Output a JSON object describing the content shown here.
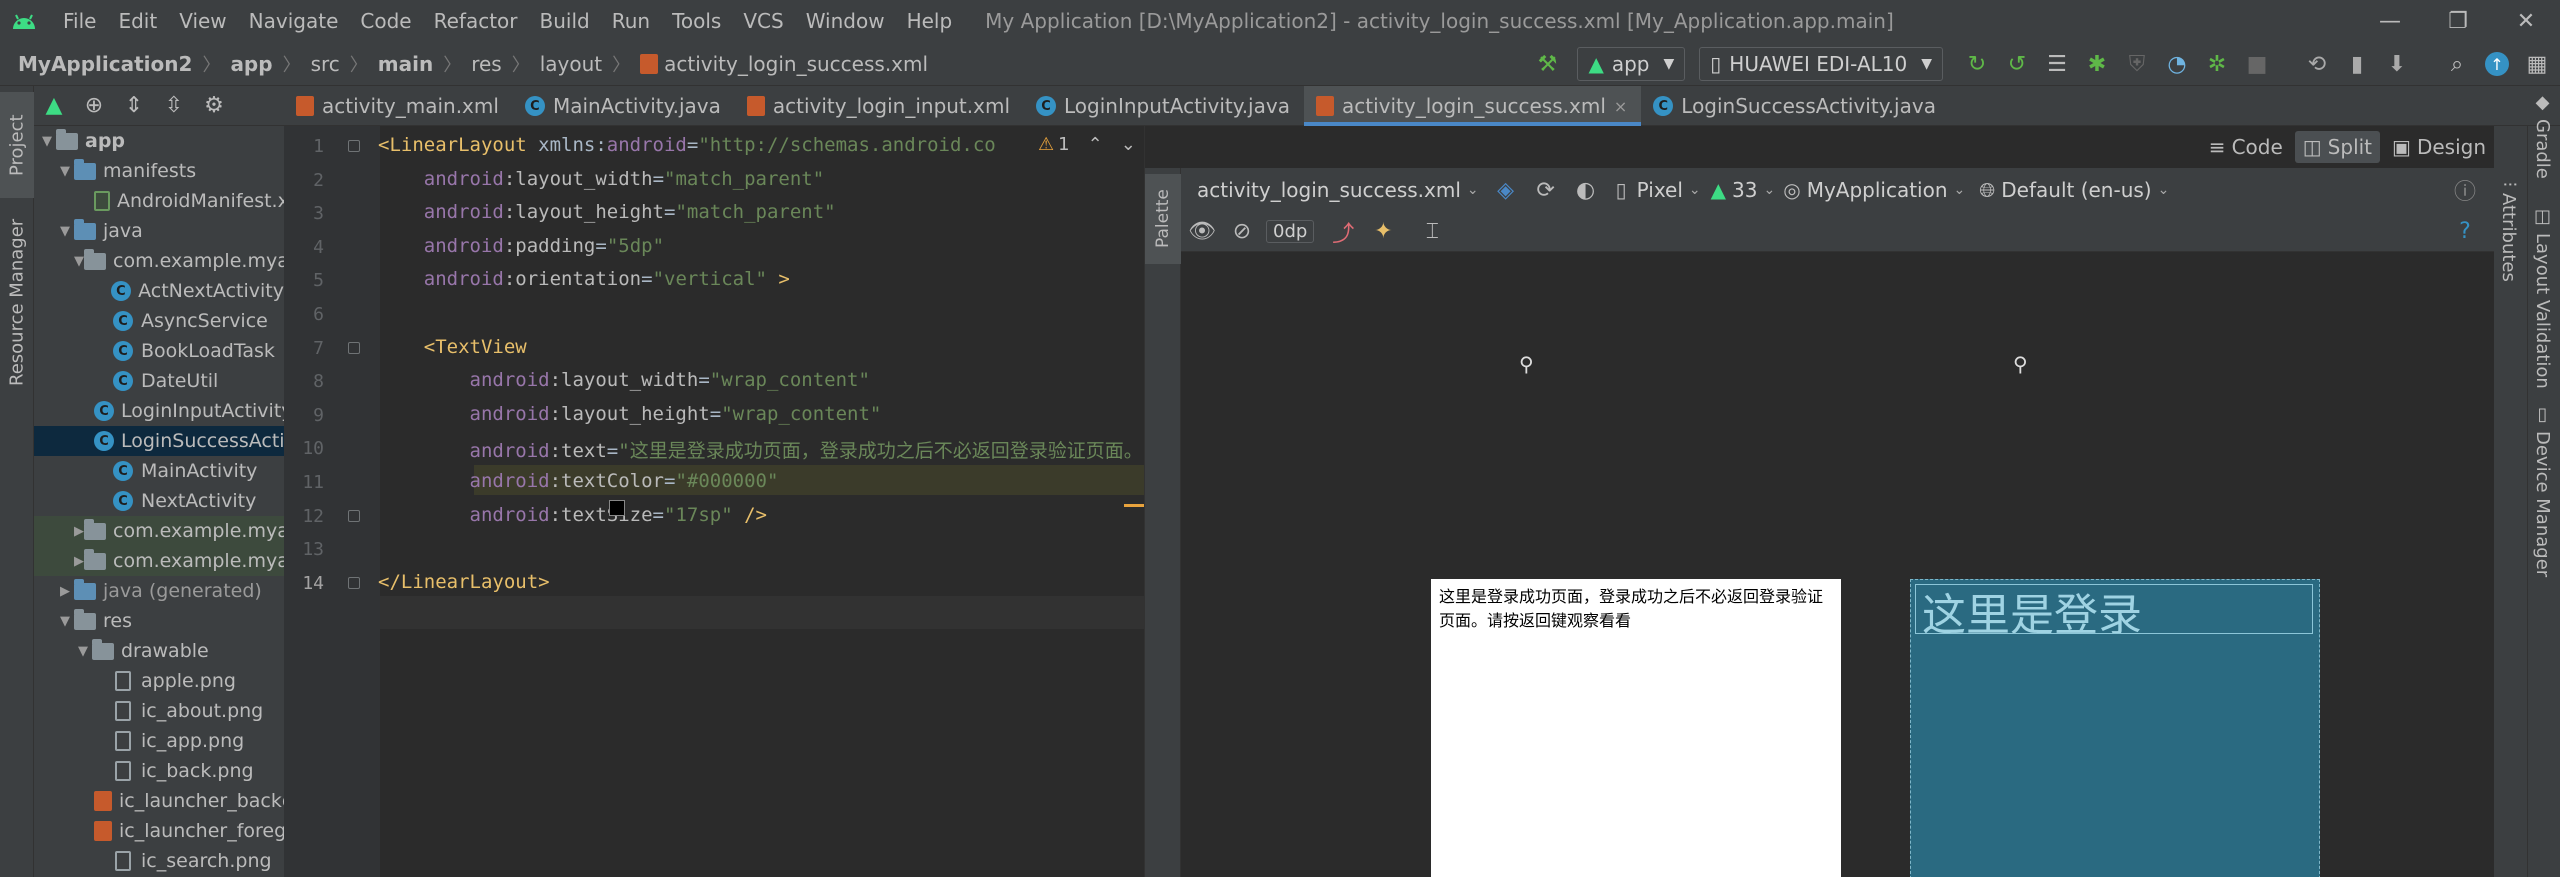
{
  "menu": [
    "File",
    "Edit",
    "View",
    "Navigate",
    "Code",
    "Refactor",
    "Build",
    "Run",
    "Tools",
    "VCS",
    "Window",
    "Help"
  ],
  "window_title": "My Application [D:\\MyApplication2] - activity_login_success.xml [My_Application.app.main]",
  "window_controls": {
    "minimize": "—",
    "restore": "❐",
    "close": "✕"
  },
  "breadcrumbs": [
    "MyApplication2",
    "app",
    "src",
    "main",
    "res",
    "layout",
    "activity_login_success.xml"
  ],
  "run_config": "app",
  "device": "HUAWEI EDI-AL10",
  "left_strip": {
    "project": "Project",
    "resource_manager": "Resource Manager"
  },
  "project_tree": [
    {
      "label": "app",
      "depth": 0,
      "arrow": "▼",
      "icon": "folder",
      "bold": true
    },
    {
      "label": "manifests",
      "depth": 1,
      "arrow": "▼",
      "icon": "folder-blue"
    },
    {
      "label": "AndroidManifest.xml",
      "depth": 3,
      "arrow": "",
      "icon": "manifest"
    },
    {
      "label": "java",
      "depth": 1,
      "arrow": "▼",
      "icon": "folder-blue"
    },
    {
      "label": "com.example.myapplication",
      "depth": 2,
      "arrow": "▼",
      "icon": "folder"
    },
    {
      "label": "ActNextActivity",
      "depth": 3,
      "arrow": "",
      "icon": "class"
    },
    {
      "label": "AsyncService",
      "depth": 3,
      "arrow": "",
      "icon": "class"
    },
    {
      "label": "BookLoadTask",
      "depth": 3,
      "arrow": "",
      "icon": "class"
    },
    {
      "label": "DateUtil",
      "depth": 3,
      "arrow": "",
      "icon": "class"
    },
    {
      "label": "LoginInputActivity",
      "depth": 3,
      "arrow": "",
      "icon": "class"
    },
    {
      "label": "LoginSuccessActivity",
      "depth": 3,
      "arrow": "",
      "icon": "class",
      "selected": true
    },
    {
      "label": "MainActivity",
      "depth": 3,
      "arrow": "",
      "icon": "class"
    },
    {
      "label": "NextActivity",
      "depth": 3,
      "arrow": "",
      "icon": "class"
    },
    {
      "label": "com.example.myapplication (androidTest)",
      "depth": 2,
      "arrow": "▶",
      "icon": "folder",
      "tinted": true
    },
    {
      "label": "com.example.myapplication (test)",
      "depth": 2,
      "arrow": "▶",
      "icon": "folder",
      "tinted": true
    },
    {
      "label": "java (generated)",
      "depth": 1,
      "arrow": "▶",
      "icon": "folder-blue",
      "dim": true
    },
    {
      "label": "res",
      "depth": 1,
      "arrow": "▼",
      "icon": "folder"
    },
    {
      "label": "drawable",
      "depth": 2,
      "arrow": "▼",
      "icon": "folder"
    },
    {
      "label": "apple.png",
      "depth": 3,
      "arrow": "",
      "icon": "image"
    },
    {
      "label": "ic_about.png",
      "depth": 3,
      "arrow": "",
      "icon": "image"
    },
    {
      "label": "ic_app.png",
      "depth": 3,
      "arrow": "",
      "icon": "image"
    },
    {
      "label": "ic_back.png",
      "depth": 3,
      "arrow": "",
      "icon": "image"
    },
    {
      "label": "ic_launcher_background.xml",
      "depth": 3,
      "arrow": "",
      "icon": "xml"
    },
    {
      "label": "ic_launcher_foreground.xml",
      "depth": 3,
      "arrow": "",
      "icon": "xml"
    },
    {
      "label": "ic_search.png",
      "depth": 3,
      "arrow": "",
      "icon": "image"
    }
  ],
  "tabs": [
    {
      "label": "activity_main.xml",
      "icon": "xml"
    },
    {
      "label": "MainActivity.java",
      "icon": "class"
    },
    {
      "label": "activity_login_input.xml",
      "icon": "xml"
    },
    {
      "label": "LoginInputActivity.java",
      "icon": "class"
    },
    {
      "label": "activity_login_success.xml",
      "icon": "xml",
      "active": true,
      "close": "×"
    },
    {
      "label": "LoginSuccessActivity.java",
      "icon": "class"
    }
  ],
  "editor": {
    "line_numbers": [
      "1",
      "2",
      "3",
      "4",
      "5",
      "6",
      "7",
      "8",
      "9",
      "10",
      "11",
      "12",
      "13",
      "14"
    ],
    "warning_count": "1",
    "lines": [
      [
        {
          "t": "tag",
          "v": "<LinearLayout"
        },
        {
          "t": "plain",
          "v": " xmlns:"
        },
        {
          "t": "ns",
          "v": "android"
        },
        {
          "t": "plain",
          "v": "="
        },
        {
          "t": "str",
          "v": "\"http://schemas.android.co"
        }
      ],
      [
        {
          "t": "plain",
          "v": "    "
        },
        {
          "t": "ns",
          "v": "android"
        },
        {
          "t": "attr",
          "v": ":layout_width"
        },
        {
          "t": "plain",
          "v": "="
        },
        {
          "t": "str",
          "v": "\"match_parent\""
        }
      ],
      [
        {
          "t": "plain",
          "v": "    "
        },
        {
          "t": "ns",
          "v": "android"
        },
        {
          "t": "attr",
          "v": ":layout_height"
        },
        {
          "t": "plain",
          "v": "="
        },
        {
          "t": "str",
          "v": "\"match_parent\""
        }
      ],
      [
        {
          "t": "plain",
          "v": "    "
        },
        {
          "t": "ns",
          "v": "android"
        },
        {
          "t": "attr",
          "v": ":padding"
        },
        {
          "t": "plain",
          "v": "="
        },
        {
          "t": "str",
          "v": "\"5dp\""
        }
      ],
      [
        {
          "t": "plain",
          "v": "    "
        },
        {
          "t": "ns",
          "v": "android"
        },
        {
          "t": "attr",
          "v": ":orientation"
        },
        {
          "t": "plain",
          "v": "="
        },
        {
          "t": "str",
          "v": "\"vertical\""
        },
        {
          "t": "tag",
          "v": " >"
        }
      ],
      [],
      [
        {
          "t": "plain",
          "v": "    "
        },
        {
          "t": "tag",
          "v": "<TextView"
        }
      ],
      [
        {
          "t": "plain",
          "v": "        "
        },
        {
          "t": "ns",
          "v": "android"
        },
        {
          "t": "attr",
          "v": ":layout_width"
        },
        {
          "t": "plain",
          "v": "="
        },
        {
          "t": "str",
          "v": "\"wrap_content\""
        }
      ],
      [
        {
          "t": "plain",
          "v": "        "
        },
        {
          "t": "ns",
          "v": "android"
        },
        {
          "t": "attr",
          "v": ":layout_height"
        },
        {
          "t": "plain",
          "v": "="
        },
        {
          "t": "str",
          "v": "\"wrap_content\""
        }
      ],
      [
        {
          "t": "plain",
          "v": "        "
        },
        {
          "t": "ns",
          "v": "android"
        },
        {
          "t": "attr",
          "v": ":text"
        },
        {
          "t": "plain",
          "v": "="
        },
        {
          "t": "str",
          "v": "\"这里是登录成功页面，登录成功之后不必返回登录验证页面。"
        }
      ],
      [
        {
          "t": "plain",
          "v": "        "
        },
        {
          "t": "ns",
          "v": "android"
        },
        {
          "t": "attr",
          "v": ":textColor"
        },
        {
          "t": "plain",
          "v": "="
        },
        {
          "t": "str",
          "v": "\"#000000\""
        }
      ],
      [
        {
          "t": "plain",
          "v": "        "
        },
        {
          "t": "ns",
          "v": "android"
        },
        {
          "t": "attr",
          "v": ":textSize"
        },
        {
          "t": "plain",
          "v": "="
        },
        {
          "t": "str",
          "v": "\"17sp\""
        },
        {
          "t": "tag",
          "v": " />"
        }
      ],
      [],
      [
        {
          "t": "tag",
          "v": "</LinearLayout>"
        }
      ]
    ]
  },
  "design_modes": {
    "code": "Code",
    "split": "Split",
    "design": "Design",
    "selected": "Split"
  },
  "design_toolbar": {
    "file": "activity_login_success.xml",
    "device": "Pixel",
    "api": "33",
    "theme": "MyApplication",
    "locale": "Default (en-us)",
    "margin": "0dp"
  },
  "palette_label": "Palette",
  "preview": {
    "text": "这里是登录成功页面，登录成功之后不必返回登录验证页面。请按返回键观察看看",
    "blueprint_text": "这里是登录"
  },
  "right_strip": {
    "gradle": "Gradle",
    "attributes": "Attributes",
    "layout_validation": "Layout Validation",
    "device_manager": "Device Manager"
  },
  "colors": {
    "accent": "#4a88c7",
    "blueprint": "#2a6a81",
    "class_icon": "#3592c4",
    "xml_icon": "#c65a2c",
    "android_green": "#3ddc84"
  }
}
